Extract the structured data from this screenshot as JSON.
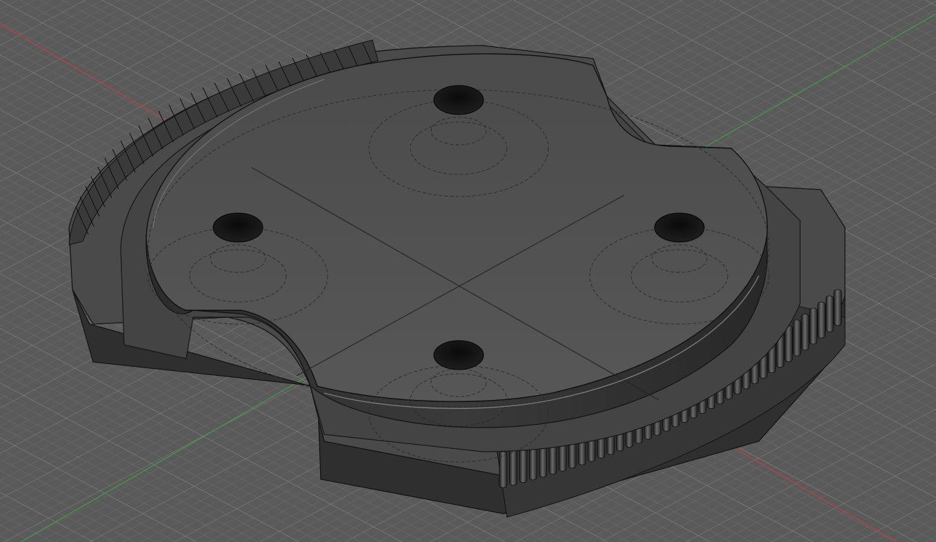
{
  "viewport": {
    "view": "3d-model-viewport",
    "style": "shaded-with-visible-edges",
    "background_color": "#565656",
    "grid": {
      "visible": true,
      "minor_color": "#707070",
      "major_color": "#7c7c7c"
    },
    "axes": {
      "x_axis_color": "#c04040",
      "y_axis_color": "#3fa040"
    }
  },
  "model": {
    "body_color": "#515151",
    "edge_color": "#1a1a1a",
    "features": {
      "top_holes": 4,
      "gear_tooth_arcs": 2,
      "notches": 2
    }
  }
}
